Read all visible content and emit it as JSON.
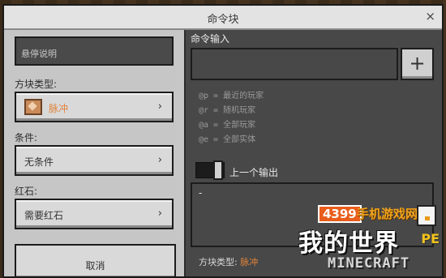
{
  "dialog": {
    "title": "命令块",
    "close_icon": "×"
  },
  "left": {
    "hover_note_placeholder": "悬停说明",
    "block_type_label": "方块类型:",
    "block_type_value": "脉冲",
    "condition_label": "条件:",
    "condition_value": "无条件",
    "redstone_label": "红石:",
    "redstone_value": "需要红石",
    "cancel_label": "取消"
  },
  "right": {
    "command_input_label": "命令输入",
    "plus_label": "+",
    "selectors": [
      "@p = 最近的玩家",
      "@r = 随机玩家",
      "@a = 全部玩家",
      "@e = 全部实体"
    ],
    "previous_output_label": "上一个输出",
    "output_text": "-",
    "status_label": "方块类型:",
    "status_value": "脉冲"
  },
  "watermark": {
    "badge": "4399",
    "tag": "手机游戏网",
    "title": "我的世界",
    "pe": "PE",
    "brand": "MINECRAFT"
  },
  "colors": {
    "accent_orange": "#e0823a",
    "panel_dark": "#484848",
    "panel_light": "#c6c6c6"
  }
}
